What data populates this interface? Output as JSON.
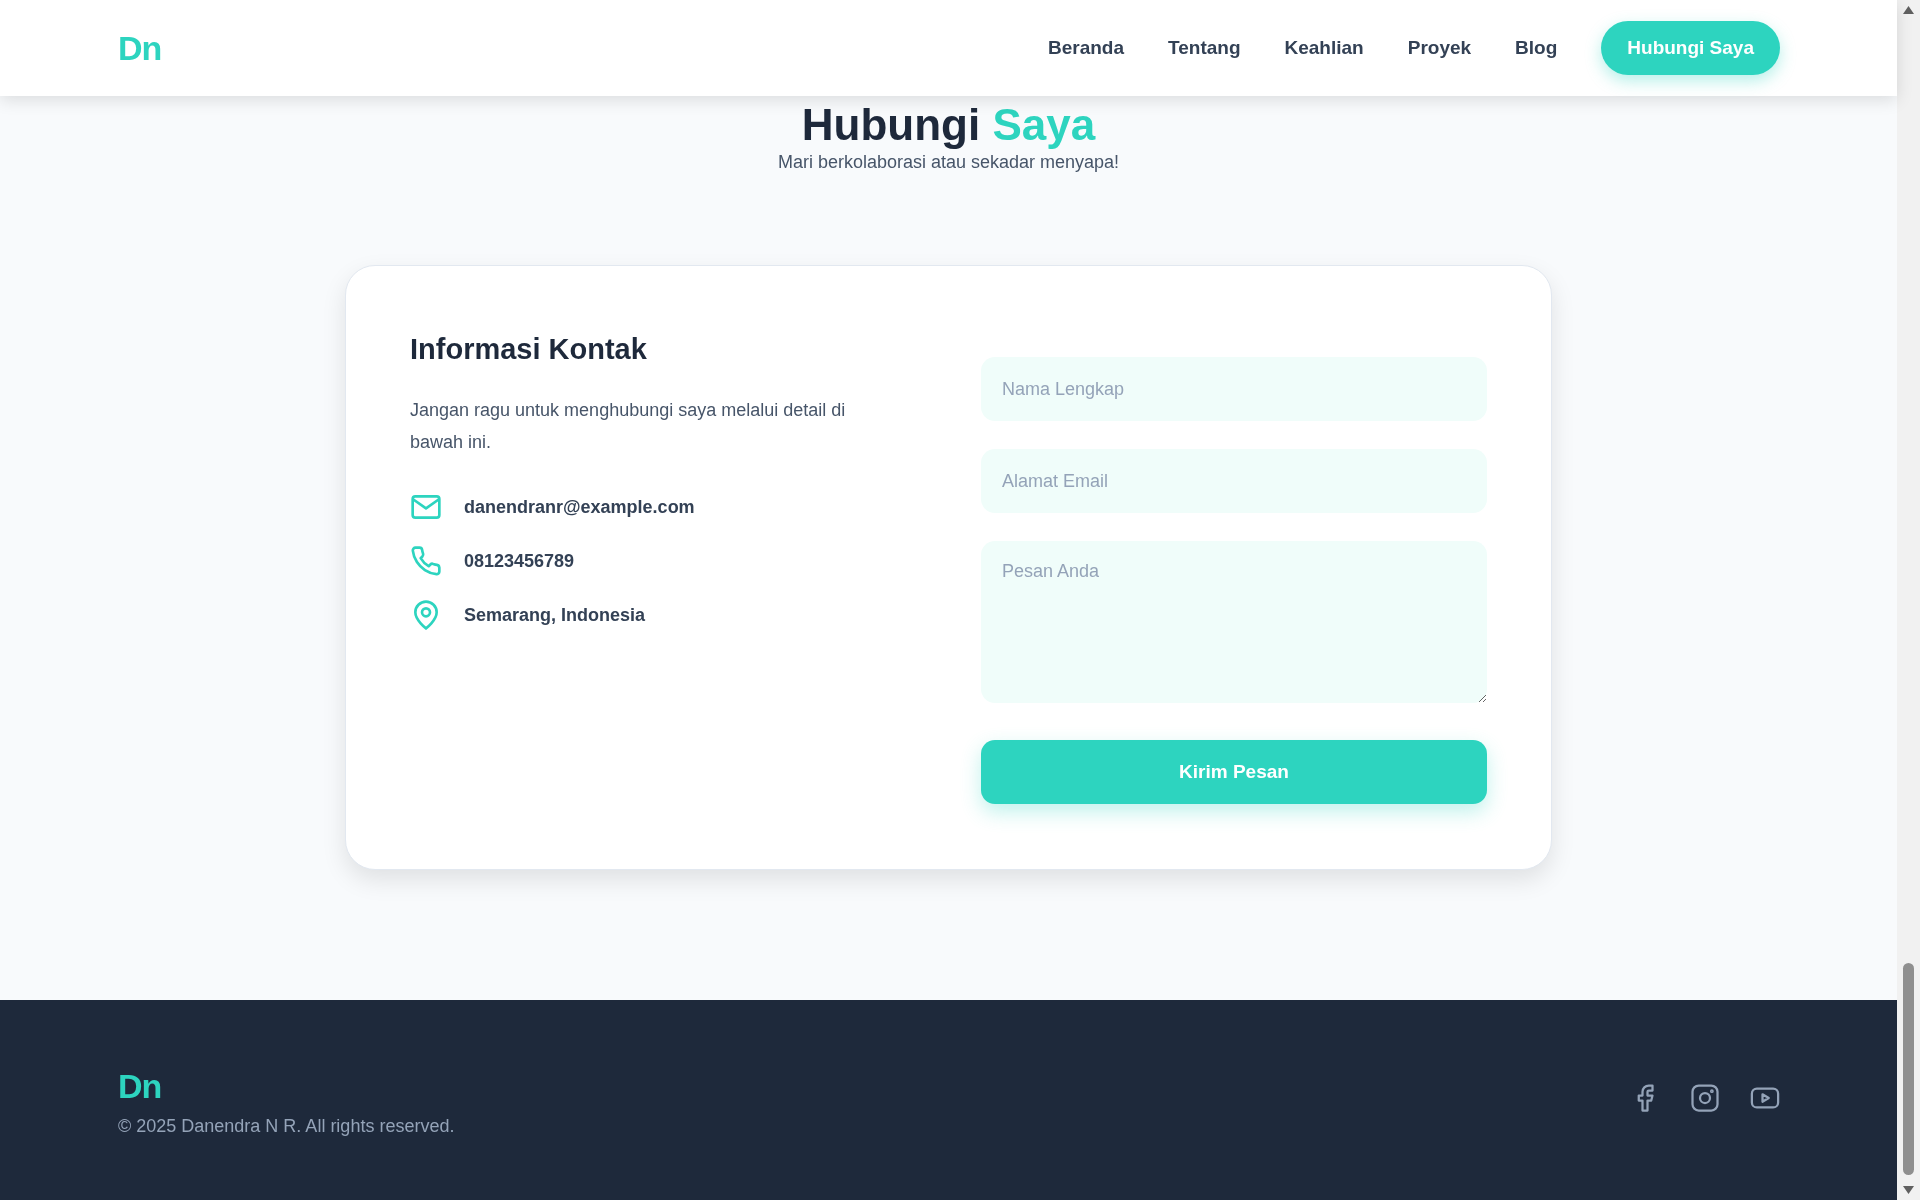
{
  "header": {
    "logo": "Dn",
    "nav": [
      {
        "label": "Beranda"
      },
      {
        "label": "Tentang"
      },
      {
        "label": "Keahlian"
      },
      {
        "label": "Proyek"
      },
      {
        "label": "Blog"
      }
    ],
    "cta": "Hubungi Saya"
  },
  "section": {
    "title": "Hubungi",
    "title_accent": "Saya",
    "subtitle": "Mari berkolaborasi atau sekadar menyapa!"
  },
  "contact_info": {
    "heading": "Informasi Kontak",
    "description": "Jangan ragu untuk menghubungi saya melalui detail di bawah ini.",
    "items": [
      {
        "kind": "email",
        "text": "danendranr@example.com"
      },
      {
        "kind": "phone",
        "text": "08123456789"
      },
      {
        "kind": "location",
        "text": "Semarang, Indonesia"
      }
    ]
  },
  "form": {
    "fields": [
      {
        "kind": "text",
        "placeholder": "Nama Lengkap"
      },
      {
        "kind": "email",
        "placeholder": "Alamat Email"
      },
      {
        "kind": "textarea",
        "placeholder": "Pesan Anda"
      }
    ],
    "submit": "Kirim Pesan"
  },
  "footer": {
    "logo": "Dn",
    "copyright": "© 2025 Danendra N R. All rights reserved.",
    "social": [
      {
        "kind": "facebook"
      },
      {
        "kind": "instagram"
      },
      {
        "kind": "youtube"
      }
    ]
  }
}
